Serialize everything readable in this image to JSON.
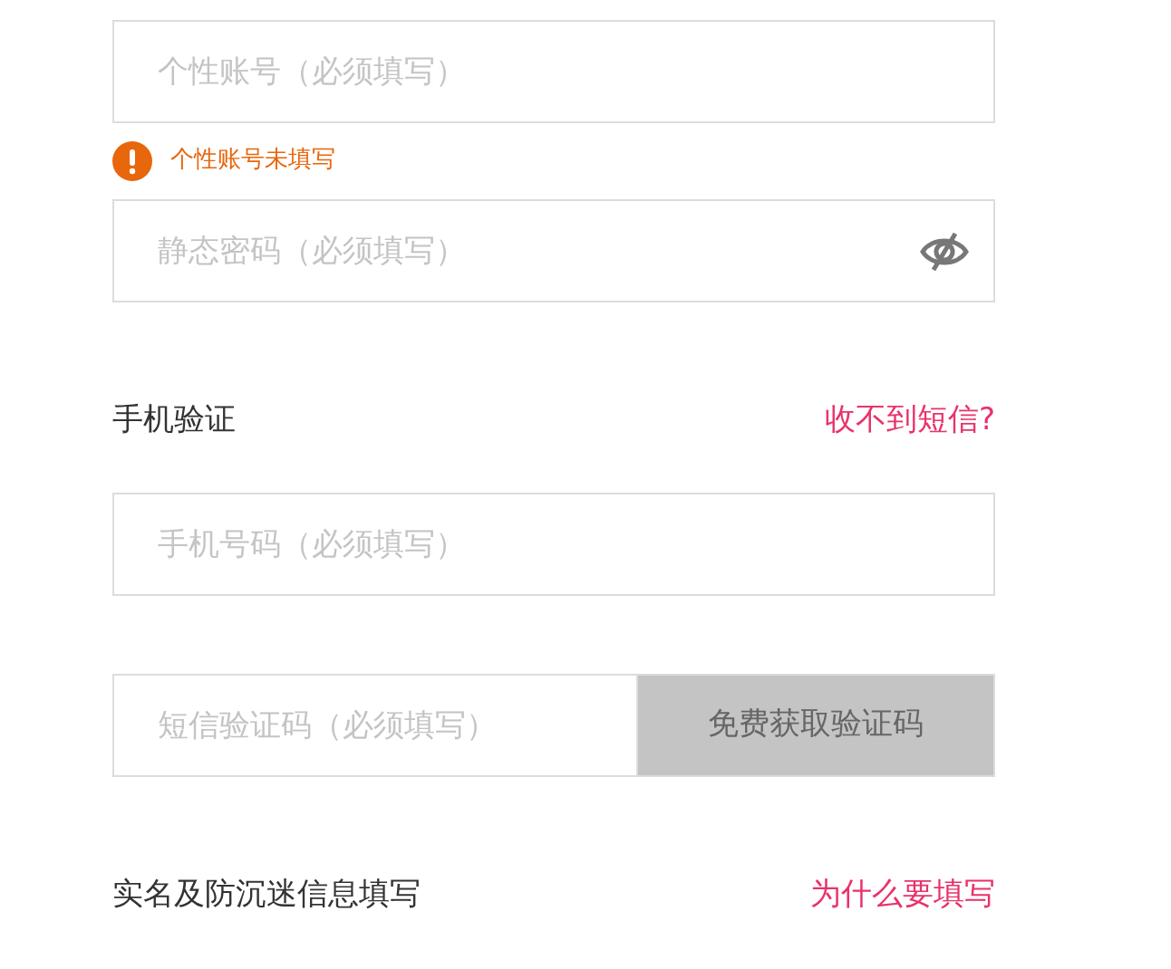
{
  "account_field": {
    "placeholder": "个性账号（必须填写）"
  },
  "account_error": {
    "message": "个性账号未填写"
  },
  "password_field": {
    "placeholder": "静态密码（必须填写）",
    "visible": false
  },
  "phone_section": {
    "title": "手机验证",
    "link": "收不到短信?"
  },
  "phone_field": {
    "placeholder": "手机号码（必须填写）"
  },
  "sms_field": {
    "placeholder": "短信验证码（必须填写）",
    "button": "免费获取验证码",
    "button_disabled": true
  },
  "realname_section": {
    "title": "实名及防沉迷信息填写",
    "link": "为什么要填写"
  }
}
